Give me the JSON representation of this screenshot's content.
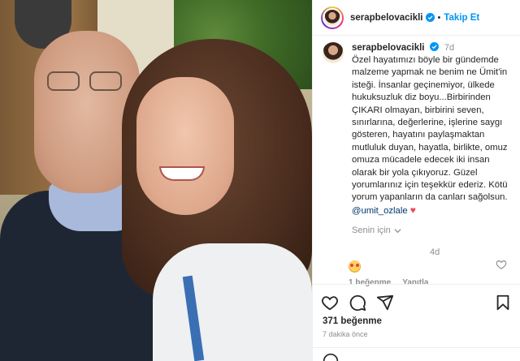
{
  "post": {
    "username": "serapbelovacikli",
    "follow_label": "Takip Et",
    "dot": "•",
    "time_ago": "7d",
    "caption": "Özel hayatımızı böyle bir gündemde malzeme yapmak ne benim ne Ümit'in isteği. İnsanlar geçinemiyor, ülkede hukuksuzluk diz boyu...Birbirinden ÇIKARI olmayan, birbirini seven, sınırlarına, değerlerine, işlerine saygı gösteren, hayatını paylaşmaktan mutluluk duyan, hayatla, birlikte, omuz omuza mücadele edecek iki insan olarak bir yola çıkıyoruz. Güzel yorumlarınız için teşekkür ederiz. Kötü yorum yapanların da canları sağolsun.",
    "mention": "@umit_ozlale",
    "translate_label": "Senin için",
    "likes_label": "371 beğenme",
    "posted_label": "7 dakika önce"
  },
  "reply": {
    "age": "4d",
    "likes_label": "1 beğenme",
    "reply_label": "Yanıtla"
  },
  "icons": {
    "verified": "verified-badge-icon",
    "like": "heart-icon",
    "comment": "comment-icon",
    "share": "share-icon",
    "save": "bookmark-icon",
    "translate_chevron": "chevron-down-icon"
  },
  "colors": {
    "accent": "#0095f6",
    "heart": "#ed4956",
    "muted": "#8e8e8e",
    "mention": "#00376b"
  }
}
